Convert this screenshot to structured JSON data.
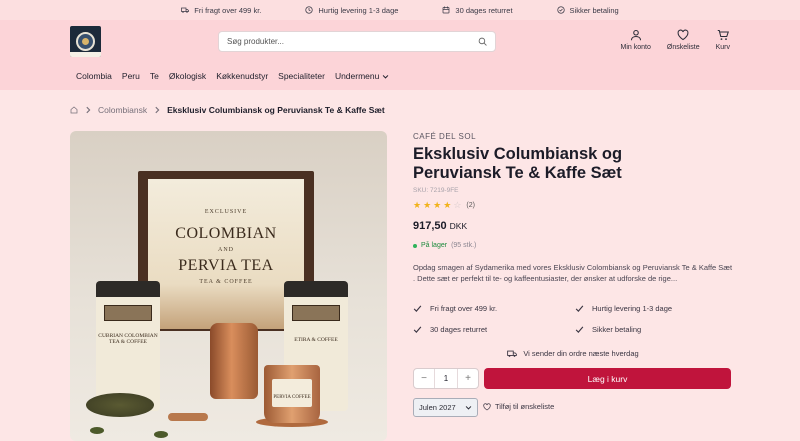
{
  "topbar": {
    "perks": [
      "Fri fragt over 499 kr.",
      "Hurtig levering 1-3 dage",
      "30 dages returret",
      "Sikker betaling"
    ]
  },
  "header": {
    "search_placeholder": "Søg produkter...",
    "account_label": "Min konto",
    "wishlist_label": "Ønskeliste",
    "cart_label": "Kurv"
  },
  "nav": {
    "items": [
      "Colombia",
      "Peru",
      "Te",
      "Økologisk",
      "Køkkenudstyr",
      "Specialiteter"
    ],
    "submenu_label": "Undermenu"
  },
  "breadcrumb": {
    "category": "Colombiansk",
    "current": "Eksklusiv Columbiansk og Peruviansk Te & Kaffe Sæt"
  },
  "image": {
    "poster_top": "EXCLUSIVE",
    "poster_line1": "COLOMBIAN",
    "poster_and": "AND",
    "poster_line2": "PERVIA TEA",
    "poster_sub": "TEA & COFFEE",
    "left_pouch": "CUBRIAN COLOMBIAN TEA & COFFEE",
    "right_pouch": "ETIRA & COFFEE",
    "mug_text": "PERVIA COFFEE"
  },
  "product": {
    "brand": "CAFÉ DEL SOL",
    "title": "Eksklusiv Columbiansk og Peruviansk Te & Kaffe Sæt",
    "sku": "SKU: 7219-9FE",
    "rating": 4,
    "rating_max": 5,
    "review_count": "(2)",
    "price": "917,50",
    "currency": "DKK",
    "stock_status": "På lager",
    "stock_count": "(95 stk.)",
    "description": "Opdag smagen af Sydamerika med vores Eksklusiv Colombiansk og Peruviansk Te & Kaffe Sæt . Dette sæt er perfekt til te- og kaffeentusiaster, der ønsker at udforske de rige...",
    "features": [
      "Fri fragt over 499 kr.",
      "Hurtig levering 1-3 dage",
      "30 dages returret",
      "Sikker betaling"
    ],
    "shipping_note": "Vi sender din ordre næste hverdag",
    "quantity": "1",
    "add_to_cart_label": "Læg i kurv",
    "variant_selected": "Julen 2027",
    "wishlist_label": "Tilføj til ønskeliste"
  },
  "colors": {
    "header_bg": "#fcd4d8",
    "page_bg": "#fde6e6",
    "primary_button": "#c0143c",
    "in_stock": "#2fb35a",
    "star": "#f1b21b"
  }
}
